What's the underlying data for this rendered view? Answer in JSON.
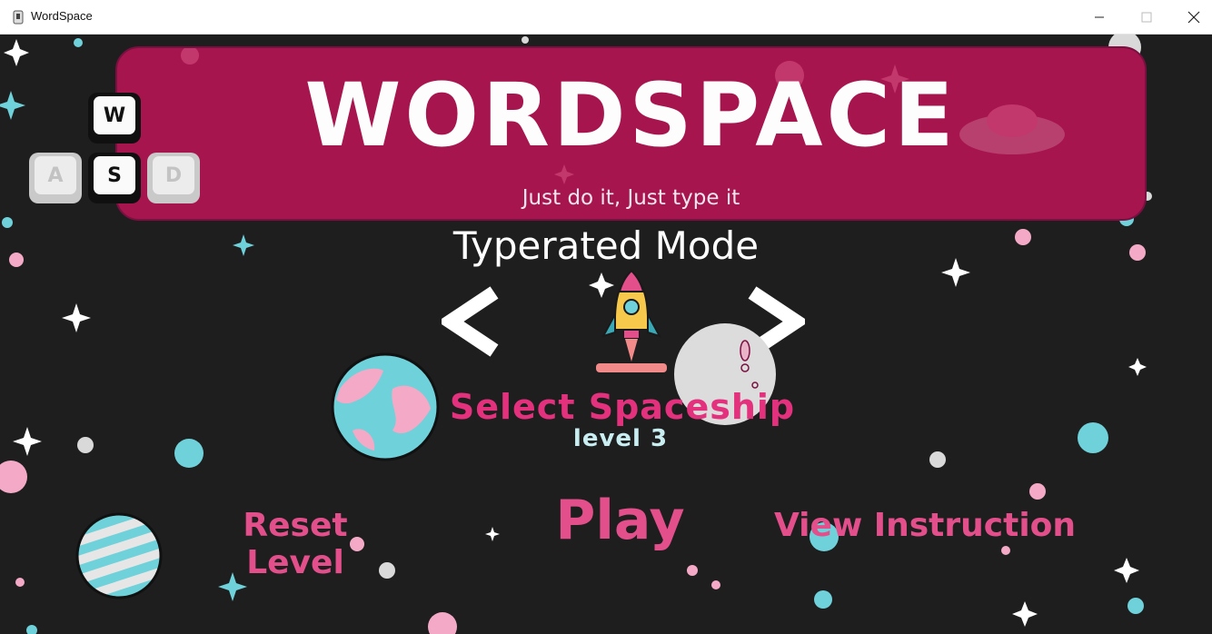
{
  "window": {
    "title": "WordSpace",
    "controls": {
      "minimize": "minimize-icon",
      "maximize": "maximize-icon",
      "close": "close-icon"
    }
  },
  "banner": {
    "title": "WORDSPACE",
    "subtitle": "Just do it, Just type it",
    "color": "#a7154f"
  },
  "keys": [
    "W",
    "A",
    "S",
    "D"
  ],
  "mode": {
    "title": "Typerated Mode"
  },
  "ship_selector": {
    "prev_icon": "chevron-left-icon",
    "next_icon": "chevron-right-icon",
    "label": "Select Spaceship",
    "level": "level 3"
  },
  "menu": {
    "reset_label": "Reset Level",
    "play_label": "Play",
    "instruction_label": "View Instruction"
  },
  "colors": {
    "accent_pink": "#e24f8b",
    "background": "#1f1e1f",
    "teal": "#6fd1d9"
  }
}
